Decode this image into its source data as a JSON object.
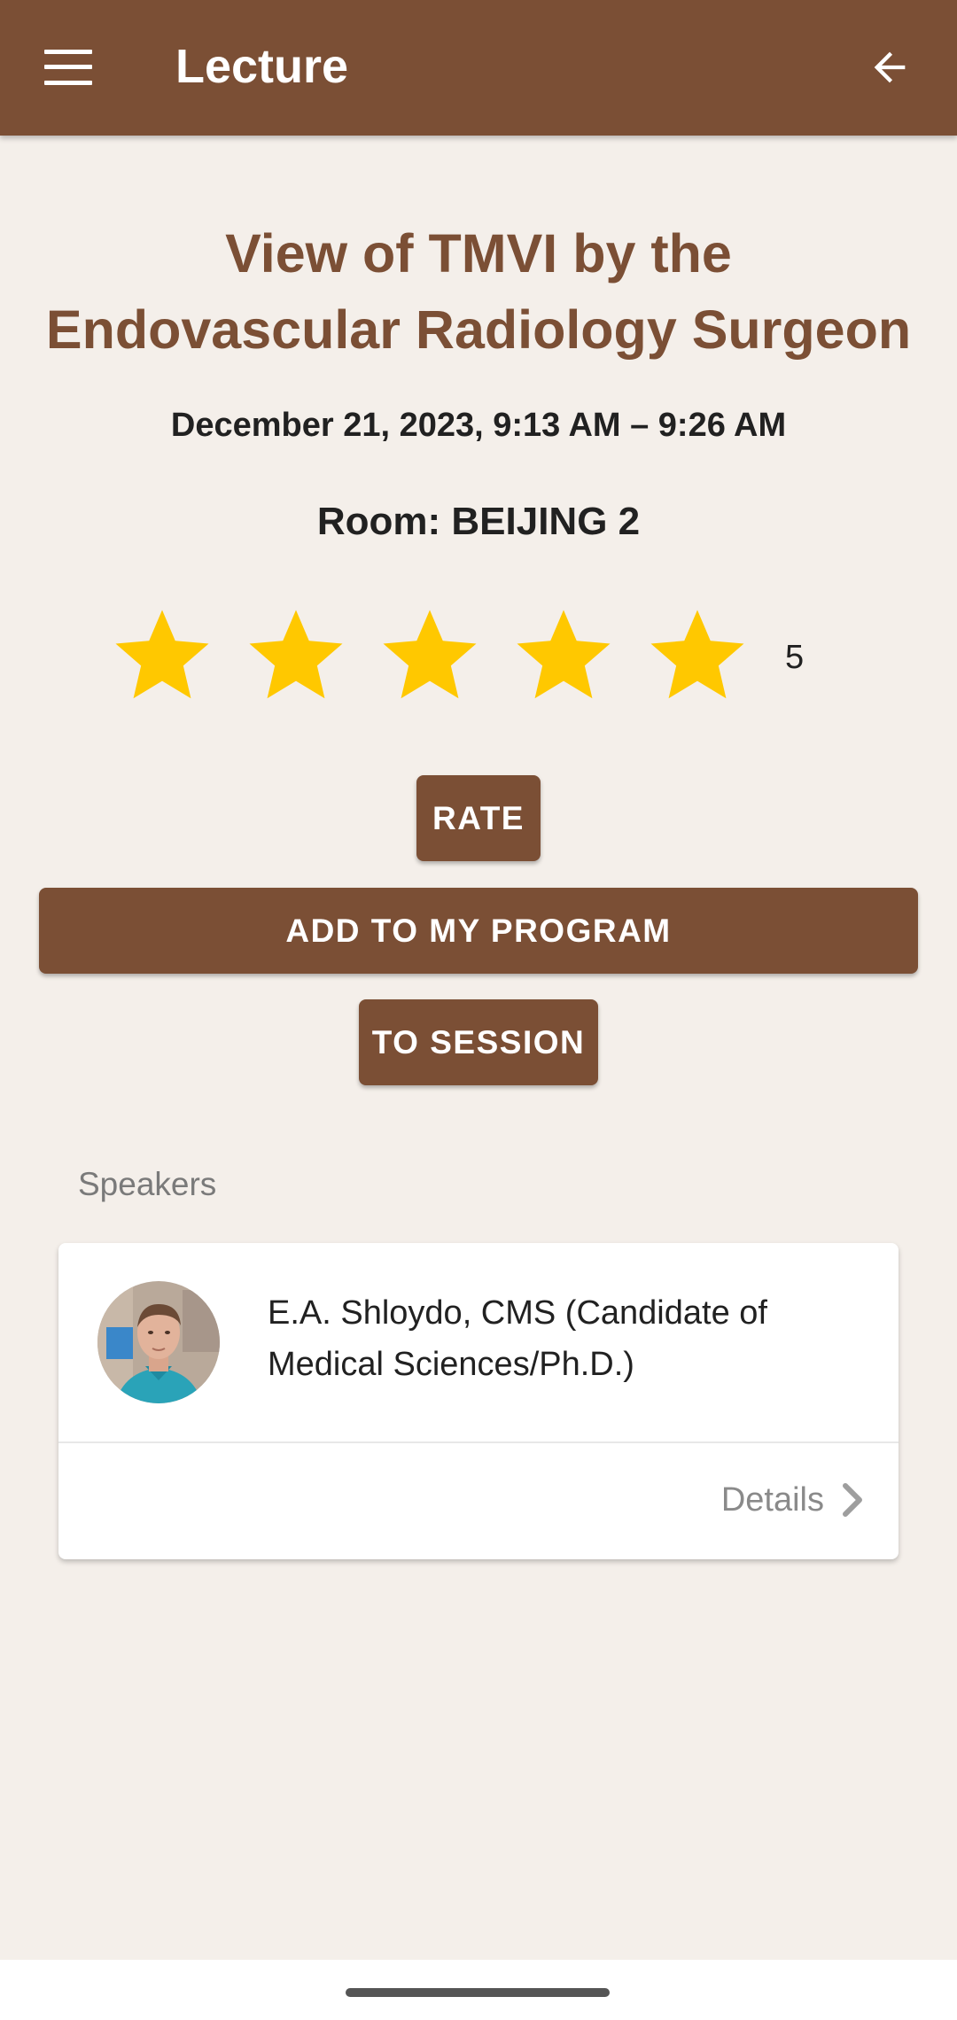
{
  "app_bar": {
    "title": "Lecture",
    "menu_icon": "hamburger-menu-icon",
    "back_icon": "arrow-left-icon",
    "background": "#7b4f35"
  },
  "lecture": {
    "title": "View of TMVI by the Endovascular Radiology Surgeon",
    "time": "December 21, 2023, 9:13 AM – 9:26 AM",
    "room": "Room: BEIJING 2"
  },
  "rating": {
    "stars_filled": 5,
    "stars_total": 5,
    "value": "5",
    "star_color": "#ffc800"
  },
  "actions": {
    "rate_label": "RATE",
    "add_program_label": "ADD TO MY PROGRAM",
    "to_session_label": "TO SESSION"
  },
  "speakers": {
    "section_label": "Speakers",
    "items": [
      {
        "name": "E.A. Shloydo, CMS (Candidate of Medical Sciences/Ph.D.)",
        "details_label": "Details"
      }
    ]
  }
}
